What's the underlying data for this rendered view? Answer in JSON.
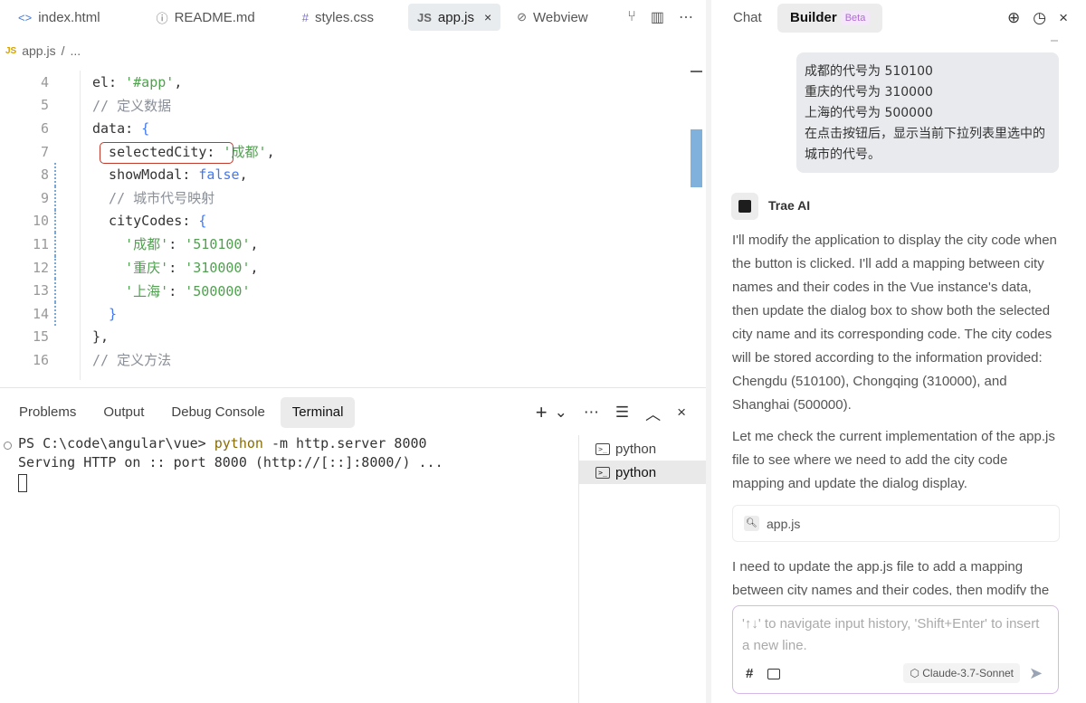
{
  "editor": {
    "tabs": [
      {
        "icon": "<>",
        "label": "index.html"
      },
      {
        "icon": "ⓘ",
        "label": "README.md"
      },
      {
        "icon": "#",
        "label": "styles.css"
      },
      {
        "icon": "JS",
        "label": "app.js",
        "close": "×"
      },
      {
        "icon": "⊘",
        "label": "Webview"
      }
    ],
    "actions": [
      "⑂",
      "▥",
      "⋯"
    ],
    "breadcrumb": {
      "icon": "JS",
      "file": "app.js",
      "sep": "/",
      "more": "..."
    },
    "lines": [
      {
        "n": "4",
        "tokens": [
          [
            "key",
            "el: "
          ],
          [
            "str",
            "'#app'"
          ],
          [
            "key",
            ","
          ]
        ]
      },
      {
        "n": "5",
        "tokens": [
          [
            "cmt",
            "// 定义数据"
          ]
        ]
      },
      {
        "n": "6",
        "tokens": [
          [
            "key",
            "data: "
          ],
          [
            "brace",
            "{"
          ]
        ]
      },
      {
        "n": "7",
        "tokens": [
          [
            "key",
            "  selectedCity: "
          ],
          [
            "str",
            "'成都'"
          ],
          [
            "key",
            ","
          ]
        ]
      },
      {
        "n": "8",
        "tokens": [
          [
            "key",
            "  showModal: "
          ],
          [
            "bool",
            "false"
          ],
          [
            "key",
            ","
          ]
        ]
      },
      {
        "n": "9",
        "tokens": [
          [
            "cmt",
            "  // 城市代号映射"
          ]
        ]
      },
      {
        "n": "10",
        "tokens": [
          [
            "key",
            "  cityCodes: "
          ],
          [
            "brace",
            "{"
          ]
        ]
      },
      {
        "n": "11",
        "tokens": [
          [
            "str",
            "    '成都'"
          ],
          [
            "key",
            ": "
          ],
          [
            "str",
            "'510100'"
          ],
          [
            "key",
            ","
          ]
        ]
      },
      {
        "n": "12",
        "tokens": [
          [
            "str",
            "    '重庆'"
          ],
          [
            "key",
            ": "
          ],
          [
            "str",
            "'310000'"
          ],
          [
            "key",
            ","
          ]
        ]
      },
      {
        "n": "13",
        "tokens": [
          [
            "str",
            "    '上海'"
          ],
          [
            "key",
            ": "
          ],
          [
            "str",
            "'500000'"
          ]
        ]
      },
      {
        "n": "14",
        "tokens": [
          [
            "brace",
            "  }"
          ]
        ]
      },
      {
        "n": "15",
        "tokens": [
          [
            "key",
            "},"
          ]
        ]
      },
      {
        "n": "16",
        "tokens": [
          [
            "cmt",
            "// 定义方法"
          ]
        ]
      }
    ]
  },
  "panel": {
    "tabs": [
      "Problems",
      "Output",
      "Debug Console",
      "Terminal"
    ],
    "actions": [
      "+",
      "⌄",
      "⋯",
      "☰",
      "︿",
      "×"
    ],
    "terminal": {
      "prompt": "PS C:\\code\\angular\\vue> ",
      "cmd": "python",
      "args": " -m http.server 8000",
      "output": "Serving HTTP on :: port 8000 (http://[::]:8000/) ..."
    },
    "terminals": [
      {
        "icon": ">_",
        "label": "python"
      },
      {
        "icon": ">_",
        "label": "python"
      }
    ]
  },
  "assistant": {
    "tabs": {
      "chat": "Chat",
      "builder": "Builder",
      "beta": "Beta"
    },
    "actions": [
      "⊕",
      "◷",
      "×"
    ],
    "user_message": "成都的代号为 510100\n重庆的代号为 310000\n上海的代号为 500000\n在点击按钮后，显示当前下拉列表里选中的城市的代号。",
    "ai_name": "Trae AI",
    "para1": "I'll modify the application to display the city code when the button is clicked. I'll add a mapping between city names and their codes in the Vue instance's data, then update the dialog box to show both the selected city name and its corresponding code. The city codes will be stored according to the information provided: Chengdu (510100), Chongqing (310000), and Shanghai (500000).",
    "para2": "Let me check the current implementation of the app.js file to see where we need to add the city code mapping and update the dialog display.",
    "file_chip": "app.js",
    "para3": "I need to update the app.js file to add a mapping between city names and their codes, then modify the",
    "composer": {
      "placeholder": "'↑↓' to navigate input history, 'Shift+Enter' to insert a new line.",
      "hash": "#",
      "model": "Claude-3.7-Sonnet",
      "send": "➤"
    }
  }
}
